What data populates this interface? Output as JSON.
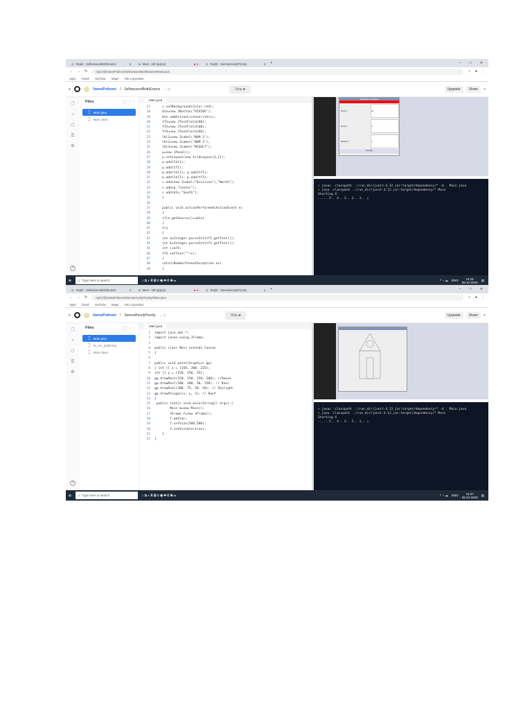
{
  "shots": [
    {
      "tabs": [
        "Replit - SelfassuredBothExams",
        "Meet - obf-rgqt-ipt",
        "Replit - SiennaHourlyPriority"
      ],
      "url": "repl.it/@VamsiPolineni/SelfassuredBothExams#Main.java",
      "bookmarks": [
        "Apps",
        "Gmail",
        "YouTube",
        "Maps",
        "Ask a Question"
      ],
      "user": "VamsiPolineni",
      "repl": "SelfassuredBothExams",
      "stop": "Stop ■",
      "upgrade": "Upgrade",
      "share": "Share",
      "files_title": "Files",
      "files": [
        "Main.java",
        "Main.class"
      ],
      "editor_tab": "Main.java",
      "code_start": 17,
      "code": [
        "    c.setBackground(Color.red);",
        "    btn=new JButton(\"DIVIDE\");",
        "    btn.addActionListener(this);",
        "    tf1=new JTextField(60);",
        "    tf2=new JTextField(60);",
        "    tf3=new JTextField(60);",
        "    lbl1=new JLabel(\"NUM 1\");",
        "    lbl2=new JLabel(\"NUM 2\");",
        "    lbl3=new JLabel(\"RESULT\");",
        "    p=new JPanel();",
        "    p.setLayout(new GridLayout(3,2));",
        "    p.add(lbl1);",
        "    p.add(tf1);",
        "    p.add(lbl2); p.add(tf2);",
        "    p.add(lbl3); p.add(tf3);",
        "    c.add(new JLabel(\"Division\"),\"North\");",
        "    c.add(p,\"Center\");",
        "    c.add(btn,\"South\");",
        "    }",
        "",
        "    public void actionPerformed(ActionEvent e)",
        "    {",
        "    if(e.getSource()==btn)",
        "    {",
        "    try",
        "    {",
        "    int a=Integer.parseInt(tf1.getText());",
        "    int b=Integer.parseInt(tf2.getText());",
        "    int c=a/b;",
        "    tf3.setText(\"\"+c);",
        "    }",
        "    catch(NumberFormatException ex)",
        "    {"
      ],
      "console": [
        "javac -classpath .:/run_dir/junit-4.12.jar:target/dependency/* -d . Main.java",
        "java -classpath .:/run_dir/junit-4.12.jar:target/dependency/* Main",
        "Starting X",
        "......5.. 4.. 3.. 2.. 1.. "
      ],
      "app": {
        "title": "Calculation Window",
        "labels": [
          "NUM 1",
          "NUM 2",
          "RESULT"
        ],
        "values": [
          "12",
          "3",
          "4"
        ],
        "button": "DIVIDE"
      },
      "taskbar": {
        "search": "Type here to search",
        "lang": "ENG",
        "time": "11:15",
        "date": "08-12-2020"
      }
    },
    {
      "tabs": [
        "Replit - SelfassuredBothExams",
        "Meet - obf-rgqt-ipt",
        "Replit - SiennaHourlyPriority"
      ],
      "url": "repl.it/@VamsiPolineni/SiennaHourlyPriority#Main.java",
      "bookmarks": [
        "Apps",
        "Gmail",
        "YouTube",
        "Maps",
        "Ask a Question"
      ],
      "user": "VamsiPolineni",
      "repl": "SiennaHourlyPriority",
      "stop": "Stop ■",
      "upgrade": "Upgrade",
      "share": "Share",
      "files_title": "Files",
      "files": [
        "Main.java",
        "hs_err_pid50.log",
        "Main.class"
      ],
      "editor_tab": "Main.java",
      "code_start": 1,
      "code": [
        "import java.awt.*;",
        "import javax.swing.JFrame;",
        "",
        "public class Main extends Canvas",
        "{",
        "",
        "public void paint(Graphics gp)",
        "{ int [] x = {150, 300, 225};",
        "int [] y = {150, 150, 25};",
        "gp.drawRect(150, 150, 150, 200); //House",
        "gp.drawRect(200, 200, 50, 150); // Door",
        "gp.drawOval(200, 75, 50, 50); // Skylight",
        "gp.drawPolygon(x, y, 3); // Roof",
        "}",
        " public static void main(String[] args) {",
        "        Main m=new Main();",
        "        JFrame f=new JFrame();",
        "        f.add(m);",
        "        f.setSize(500,500);",
        "        f.setVisible(true);",
        "    }",
        "}"
      ],
      "console": [
        "javac -classpath .:/run_dir/junit-4.12.jar:target/dependency/* -d . Main.java",
        "java -classpath .:/run_dir/junit-4.12.jar:target/dependency/* Main",
        "Starting X",
        "......5.. 4.. 3.. 2.. 1.. "
      ],
      "taskbar": {
        "search": "Type here to search",
        "lang": "ENG",
        "time": "11:37",
        "date": "08-12-2020"
      }
    }
  ]
}
